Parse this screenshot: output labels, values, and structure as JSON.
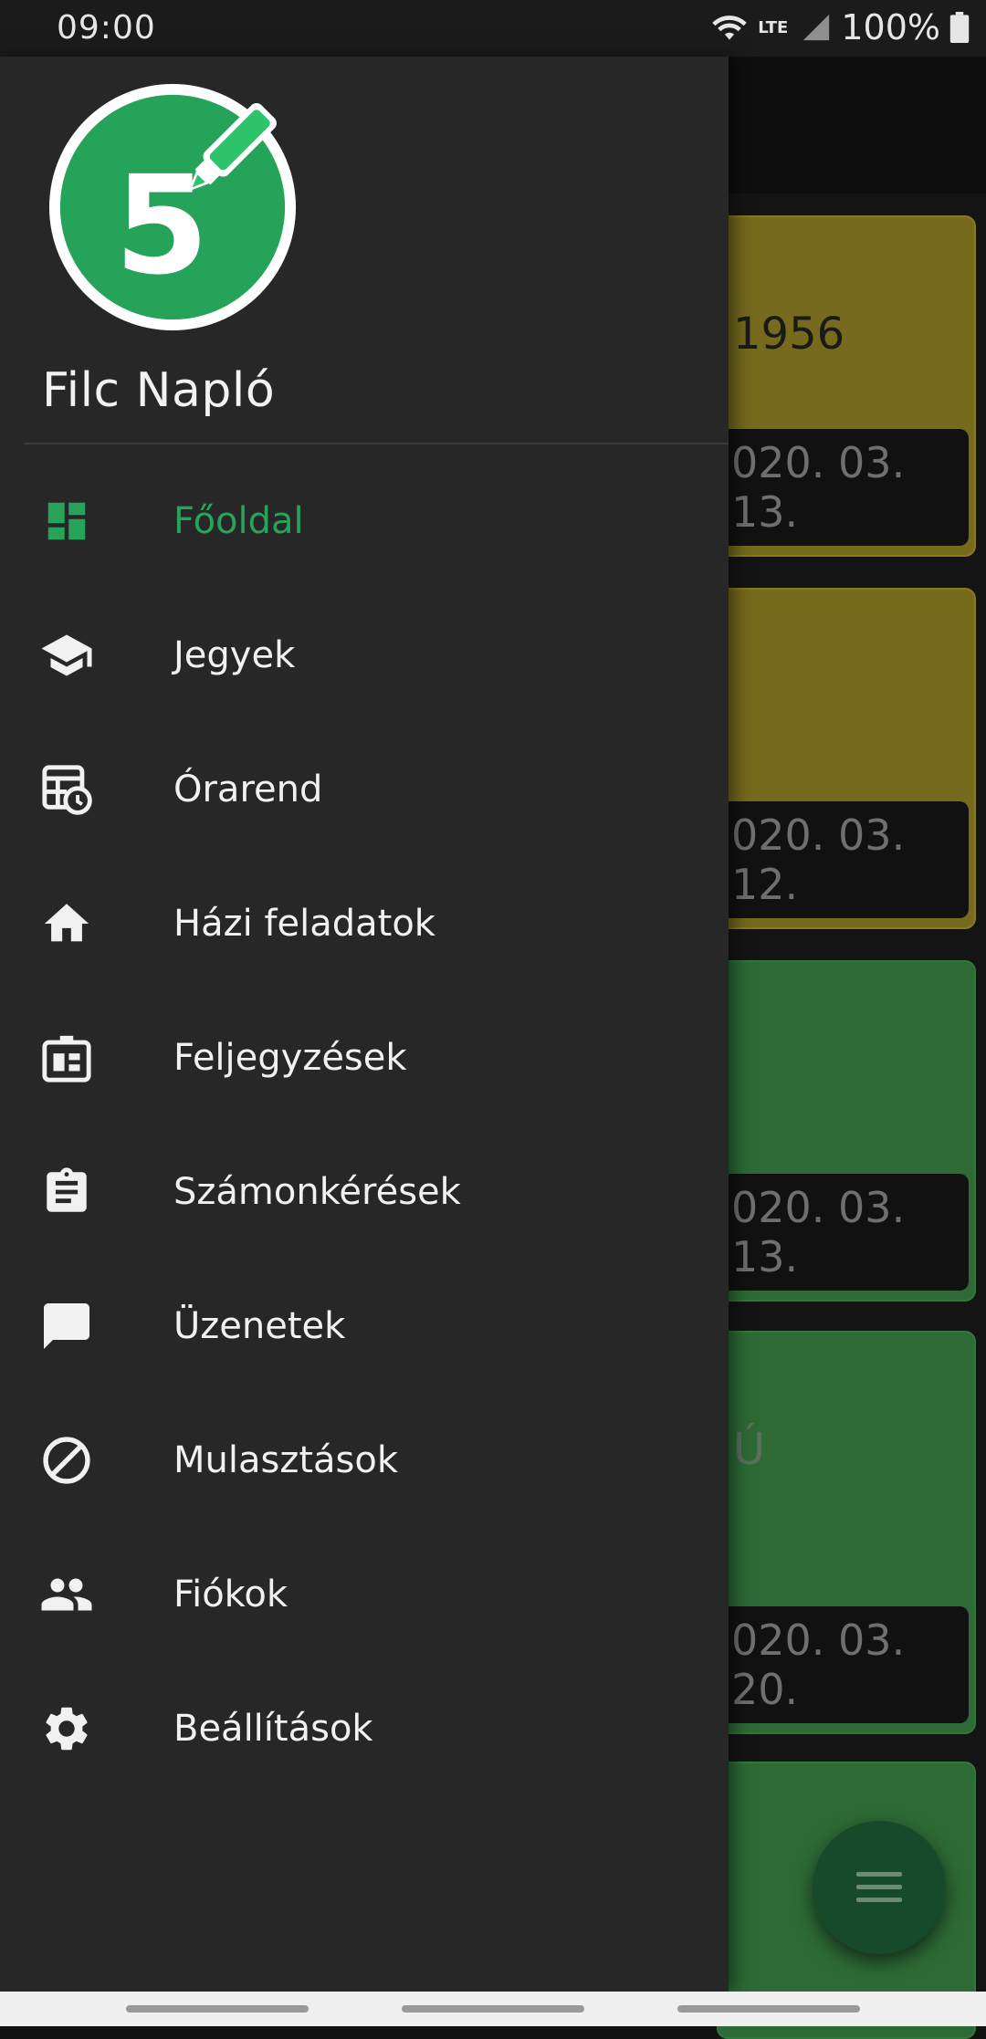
{
  "status_bar": {
    "time": "09:00",
    "network": "LTE",
    "battery": "100%"
  },
  "drawer": {
    "app_name": "Filc Napló",
    "logo_number": "5",
    "items": [
      {
        "label": "Főoldal",
        "icon": "dashboard-icon",
        "active": true
      },
      {
        "label": "Jegyek",
        "icon": "graduation-cap-icon"
      },
      {
        "label": "Órarend",
        "icon": "timetable-icon"
      },
      {
        "label": "Házi feladatok",
        "icon": "home-icon"
      },
      {
        "label": "Feljegyzések",
        "icon": "notes-badge-icon"
      },
      {
        "label": "Számonkérések",
        "icon": "clipboard-icon"
      },
      {
        "label": "Üzenetek",
        "icon": "chat-bubble-icon"
      },
      {
        "label": "Mulasztások",
        "icon": "block-icon"
      },
      {
        "label": "Fiókok",
        "icon": "people-icon"
      },
      {
        "label": "Beállítások",
        "icon": "gear-icon"
      }
    ]
  },
  "background_cards": [
    {
      "title": "1956",
      "date": "020. 03. 13.",
      "color": "#766a1d"
    },
    {
      "title": "",
      "date": "020. 03. 12.",
      "color": "#766a1d"
    },
    {
      "title": "",
      "date": "020. 03. 13.",
      "color": "#2d6a36"
    },
    {
      "title": "Ú",
      "date": "020. 03. 20.",
      "color": "#2d6a36"
    },
    {
      "title": "",
      "date": "",
      "color": "#2d6a36"
    }
  ],
  "colors": {
    "accent": "#27a35a",
    "drawer_bg": "#272727"
  }
}
